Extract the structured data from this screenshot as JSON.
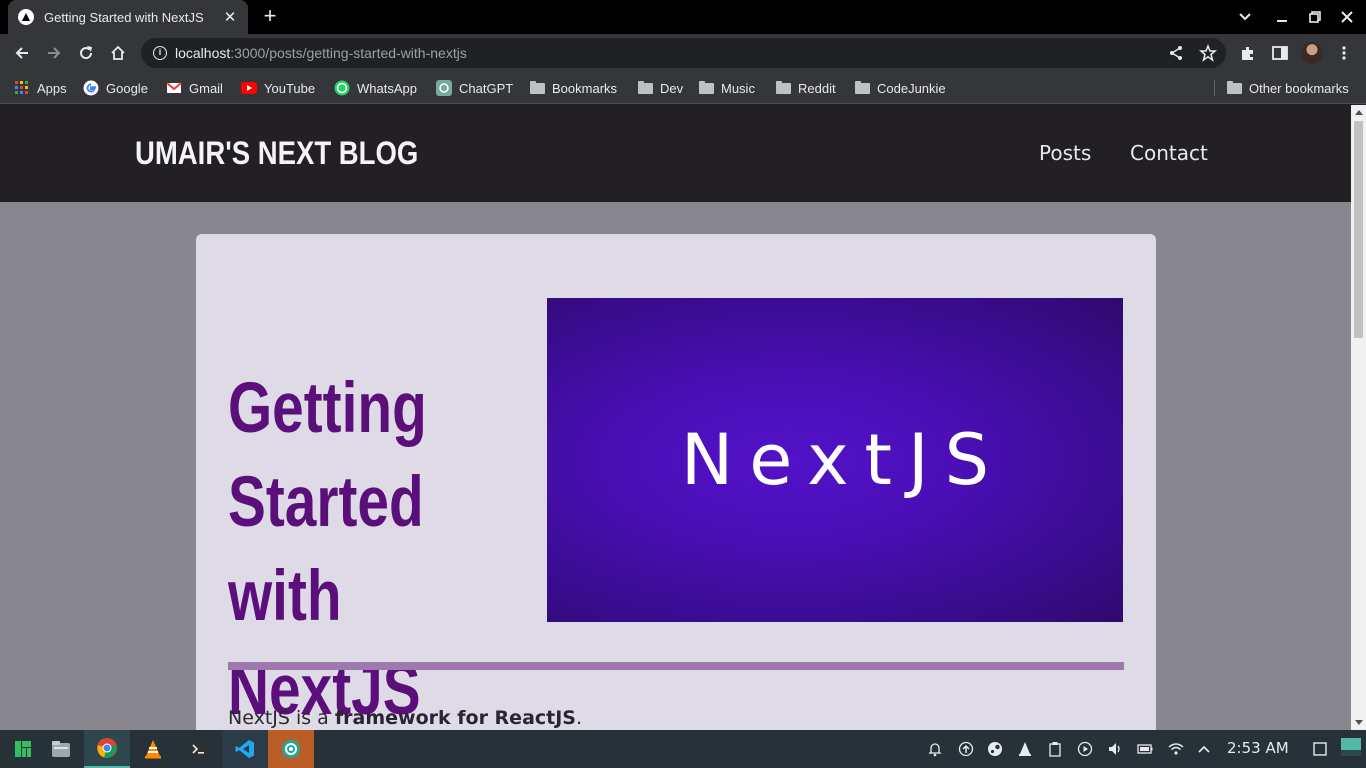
{
  "browser": {
    "tab_title": "Getting Started with NextJS",
    "url_host": "localhost",
    "url_path": ":3000/posts/getting-started-with-nextjs"
  },
  "bookmarks": [
    {
      "label": "Apps",
      "icon": "apps-grid-icon"
    },
    {
      "label": "Google",
      "icon": "google-icon"
    },
    {
      "label": "Gmail",
      "icon": "gmail-icon"
    },
    {
      "label": "YouTube",
      "icon": "youtube-icon"
    },
    {
      "label": "WhatsApp",
      "icon": "whatsapp-icon"
    },
    {
      "label": "ChatGPT",
      "icon": "chatgpt-icon"
    },
    {
      "label": "Bookmarks",
      "icon": "folder-icon"
    },
    {
      "label": "Dev",
      "icon": "folder-icon"
    },
    {
      "label": "Music",
      "icon": "folder-icon"
    },
    {
      "label": "Reddit",
      "icon": "folder-icon"
    },
    {
      "label": "CodeJunkie",
      "icon": "folder-icon"
    }
  ],
  "other_bookmarks": "Other bookmarks",
  "site": {
    "logo": "UMAIR'S NEXT BLOG",
    "nav": [
      "Posts",
      "Contact"
    ]
  },
  "post": {
    "title": "Getting Started with NextJS",
    "hero_text": "NextJS",
    "intro_prefix": "NextJS is a ",
    "intro_bold": "framework for ReactJS",
    "intro_suffix": "."
  },
  "taskbar": {
    "apps": [
      "manjaro-icon",
      "files-icon",
      "chrome-icon",
      "vlc-icon",
      "terminal-icon",
      "vscode-icon",
      "app-icon"
    ],
    "clock": "2:53 AM"
  },
  "colors": {
    "header_bg": "#222023",
    "page_bg": "#88868d",
    "card_bg": "#dedbe6",
    "title_purple": "#5b0f7a",
    "divider": "#9e7aac",
    "hero_purple": "#4a0fb6"
  }
}
